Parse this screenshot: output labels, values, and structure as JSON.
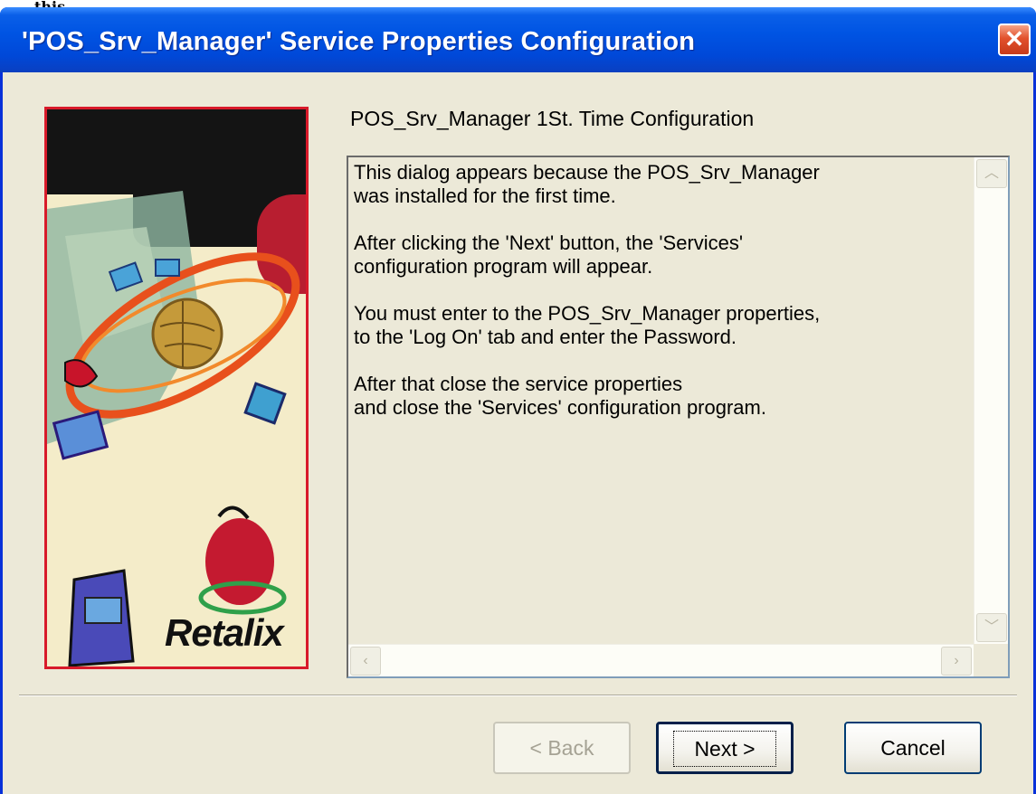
{
  "outside_text": "this.",
  "window": {
    "title": "'POS_Srv_Manager' Service Properties Configuration",
    "close_glyph": "✕"
  },
  "banner": {
    "brand": "Retalix"
  },
  "heading": "POS_Srv_Manager 1St. Time Configuration",
  "message": {
    "paragraphs": [
      "This dialog appears because the POS_Srv_Manager\nwas installed for the first time.",
      "After clicking the 'Next' button, the 'Services'\nconfiguration program will appear.",
      "You must enter to the POS_Srv_Manager properties,\nto the 'Log On' tab and enter the Password.",
      "After that close the service properties\nand close the 'Services' configuration program."
    ]
  },
  "scroll": {
    "up": "︿",
    "down": "﹀",
    "left": "‹",
    "right": "›"
  },
  "buttons": {
    "back": "< Back",
    "next": "Next >",
    "cancel": "Cancel"
  },
  "colors": {
    "titlebar": "#0054e3",
    "client": "#ece9d8",
    "close": "#e2512c",
    "banner_border": "#d81a2a"
  }
}
